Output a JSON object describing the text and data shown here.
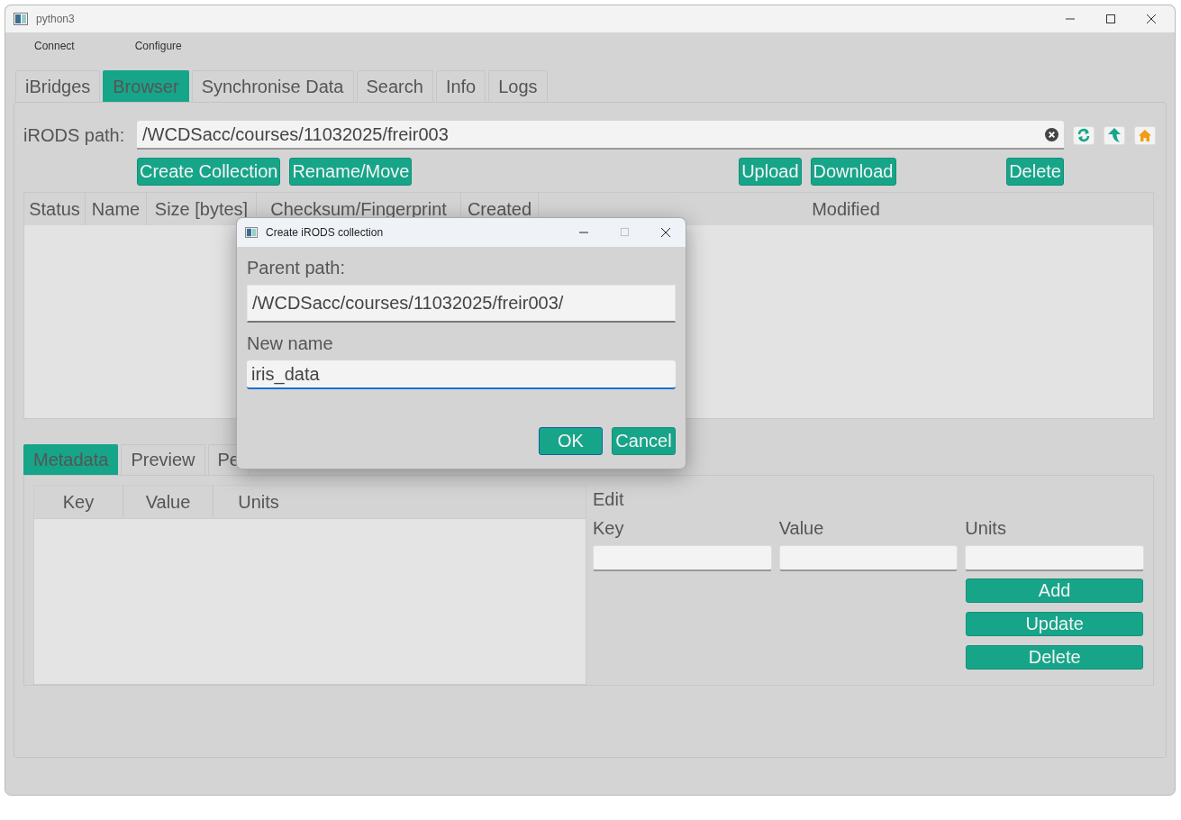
{
  "window": {
    "title": "python3"
  },
  "menu": [
    "Connect",
    "Configure"
  ],
  "tabs": [
    {
      "label": "iBridges",
      "selected": false
    },
    {
      "label": "Browser",
      "selected": true
    },
    {
      "label": "Synchronise Data",
      "selected": false
    },
    {
      "label": "Search",
      "selected": false
    },
    {
      "label": "Info",
      "selected": false
    },
    {
      "label": "Logs",
      "selected": false
    }
  ],
  "browser": {
    "path_label": "iRODS path:",
    "path": "/WCDSacc/courses/11032025/freir003",
    "action_groups": [
      [
        "Create Collection",
        "Rename/Move"
      ],
      [
        "Upload",
        "Download"
      ],
      [
        "Delete"
      ]
    ],
    "columns": [
      "Status",
      "Name",
      "Size [bytes]",
      "Checksum/Fingerprint",
      "Created",
      "Modified"
    ]
  },
  "detail_tabs": [
    {
      "label": "Metadata",
      "selected": true
    },
    {
      "label": "Preview",
      "selected": false
    },
    {
      "label": "Pe",
      "selected": false
    }
  ],
  "metadata": {
    "columns": [
      "Key",
      "Value",
      "Units"
    ],
    "edit_title": "Edit",
    "fields": [
      "Key",
      "Value",
      "Units"
    ],
    "buttons": [
      "Add",
      "Update",
      "Delete"
    ]
  },
  "dialog": {
    "title": "Create iRODS collection",
    "parent_label": "Parent path:",
    "parent_path": "/WCDSacc/courses/11032025/freir003/",
    "name_label": "New name",
    "name_value": "iris_data",
    "buttons": [
      "OK",
      "Cancel"
    ]
  }
}
